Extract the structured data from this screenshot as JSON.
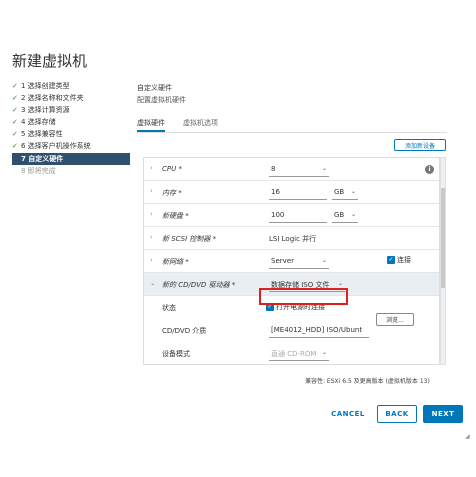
{
  "dialog": {
    "title": "新建虚拟机"
  },
  "steps": [
    {
      "label": "1 选择创建类型",
      "state": "done"
    },
    {
      "label": "2 选择名称和文件夹",
      "state": "done"
    },
    {
      "label": "3 选择计算资源",
      "state": "done"
    },
    {
      "label": "4 选择存储",
      "state": "done"
    },
    {
      "label": "5 选择兼容性",
      "state": "done"
    },
    {
      "label": "6 选择客户机操作系统",
      "state": "done"
    },
    {
      "label": "7 自定义硬件",
      "state": "current"
    },
    {
      "label": "8 即将完成",
      "state": "future"
    }
  ],
  "content": {
    "header_title": "自定义硬件",
    "header_subtitle": "配置虚拟机硬件",
    "tabs": [
      {
        "label": "虚拟硬件",
        "active": true
      },
      {
        "label": "虚拟机选项",
        "active": false
      }
    ],
    "add_device_label": "添加新设备",
    "info_icon_glyph": "i"
  },
  "hardware": {
    "cpu": {
      "label": "CPU *",
      "value": "8"
    },
    "memory": {
      "label": "内存 *",
      "value": "16",
      "unit": "GB"
    },
    "disk": {
      "label": "新硬盘 *",
      "value": "100",
      "unit": "GB"
    },
    "scsi": {
      "label": "新 SCSI 控制器 *",
      "value": "LSI Logic 并行"
    },
    "network": {
      "label": "新网络 *",
      "value": "Server",
      "connect_label": "连接"
    },
    "cddvd": {
      "label": "新的 CD/DVD 驱动器 *",
      "value": "数据存储 ISO 文件",
      "status_label": "状态",
      "power_on_label": "打开电源时连接",
      "media_label": "CD/DVD 介质",
      "media_value": "[ME4012_HDD] ISO/Ubunt",
      "browse_label": "浏览...",
      "device_mode_label": "设备模式",
      "device_mode_value": "直通 CD-ROM"
    }
  },
  "footer": {
    "compat_text": "兼容性: ESXi 6.5 及更高版本 (虚拟机版本 13)",
    "cancel_label": "CANCEL",
    "back_label": "BACK",
    "next_label": "NEXT"
  },
  "colors": {
    "accent": "#0077b8",
    "current_step_bg": "#2f4f6f",
    "highlight": "#e02020"
  }
}
